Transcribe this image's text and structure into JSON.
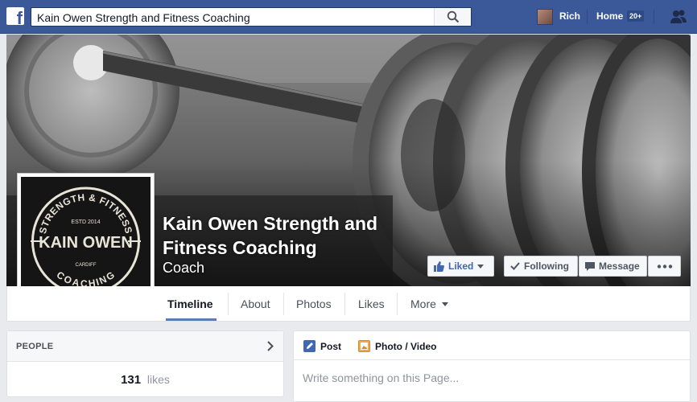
{
  "topbar": {
    "logo": "f",
    "search_value": "Kain Owen Strength and Fitness Coaching",
    "user_name": "Rich",
    "home_label": "Home",
    "home_badge": "20+",
    "colors": {
      "bar": "#3b5998"
    }
  },
  "page": {
    "name": "Kain Owen Strength and Fitness Coaching",
    "category": "Coach",
    "logo_text": {
      "arc_top": "STRENGTH & FITNESS",
      "est": "ESTD 2014",
      "name": "KAIN OWEN",
      "city": "CARDIFF",
      "arc_bottom": "COACHING"
    }
  },
  "actions": {
    "liked": "Liked",
    "following": "Following",
    "message": "Message",
    "more_icon": "ellipsis-icon"
  },
  "tabs": [
    {
      "label": "Timeline",
      "active": true
    },
    {
      "label": "About"
    },
    {
      "label": "Photos"
    },
    {
      "label": "Likes"
    },
    {
      "label": "More"
    }
  ],
  "people": {
    "title": "PEOPLE",
    "count": "131",
    "suffix": "likes"
  },
  "composer": {
    "post_label": "Post",
    "photo_label": "Photo / Video",
    "placeholder": "Write something on this Page..."
  }
}
